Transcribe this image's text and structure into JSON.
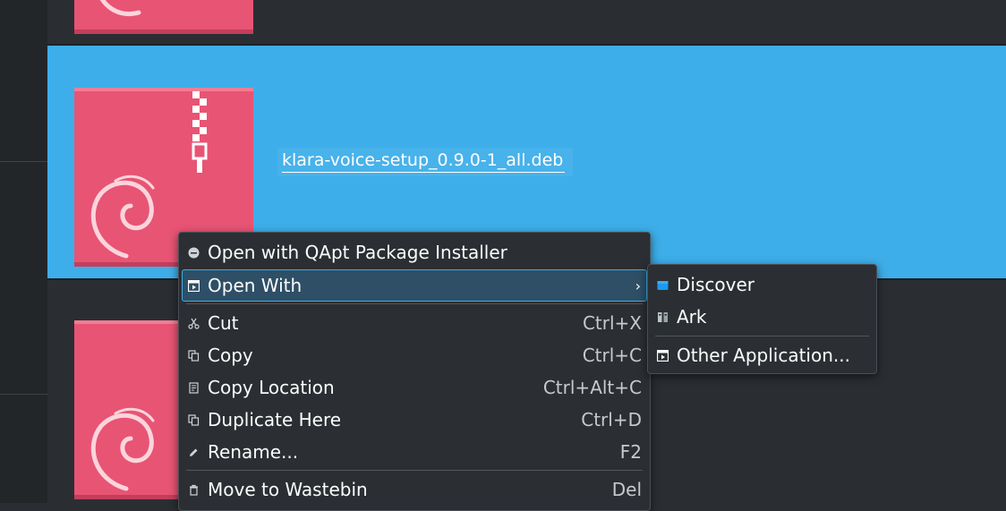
{
  "file": {
    "name": "klara-voice-setup_0.9.0-1_all.deb"
  },
  "context_menu": {
    "items": [
      {
        "label": "Open with QApt Package Installer",
        "shortcut": "",
        "icon": "package-installer-icon"
      },
      {
        "label": "Open With",
        "shortcut": "",
        "icon": "open-with-icon",
        "submenu": true,
        "active": true
      },
      {
        "label": "Cut",
        "shortcut": "Ctrl+X",
        "icon": "scissors-icon"
      },
      {
        "label": "Copy",
        "shortcut": "Ctrl+C",
        "icon": "copy-icon"
      },
      {
        "label": "Copy Location",
        "shortcut": "Ctrl+Alt+C",
        "icon": "copy-location-icon"
      },
      {
        "label": "Duplicate Here",
        "shortcut": "Ctrl+D",
        "icon": "duplicate-icon"
      },
      {
        "label": "Rename...",
        "shortcut": "F2",
        "icon": "pencil-icon"
      },
      {
        "label": "Move to Wastebin",
        "shortcut": "Del",
        "icon": "trash-icon"
      }
    ],
    "arrow": "›"
  },
  "submenu": {
    "items": [
      {
        "label": "Discover",
        "icon": "discover-icon"
      },
      {
        "label": "Ark",
        "icon": "ark-icon"
      },
      {
        "label": "Other Application...",
        "icon": "other-application-icon"
      }
    ]
  },
  "colors": {
    "selection": "#3daee9",
    "background": "#2a2e32",
    "debian_icon": "#e85474",
    "menu_background": "#2b2f33"
  }
}
